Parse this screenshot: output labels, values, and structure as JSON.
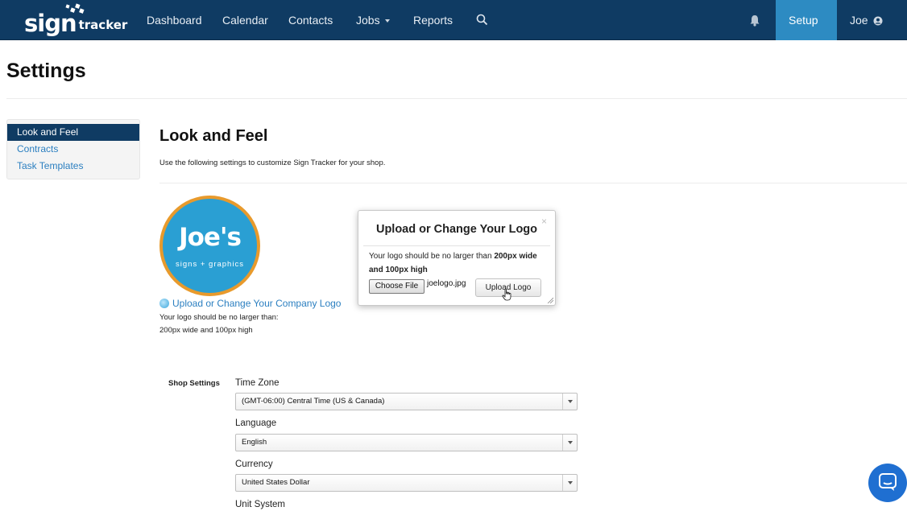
{
  "nav": {
    "brand_sign": "sign",
    "brand_tracker": "tracker",
    "items": [
      {
        "label": "Dashboard"
      },
      {
        "label": "Calendar"
      },
      {
        "label": "Contacts"
      },
      {
        "label": "Jobs"
      },
      {
        "label": "Reports"
      }
    ],
    "search_icon": "search-icon",
    "bell_icon": "bell-icon",
    "setup_label": "Setup",
    "user_label": "Joe",
    "user_icon": "user-circle-icon",
    "colors": {
      "bar": "#0f3b63",
      "setup_active": "#2d8bc2"
    }
  },
  "page": {
    "title": "Settings"
  },
  "sidebar": {
    "items": [
      {
        "label": "Look and Feel",
        "active": true
      },
      {
        "label": "Contracts",
        "active": false
      },
      {
        "label": "Task Templates",
        "active": false
      }
    ]
  },
  "main": {
    "title": "Look and Feel",
    "description": "Use the following settings to customize Sign Tracker for your shop.",
    "company_logo": {
      "name": "Joe's",
      "tagline": "signs + graphics"
    },
    "upload_link": "Upload or Change Your Company Logo",
    "logo_note_1": "Your logo should be no larger than:",
    "logo_note_2": "200px wide and 100px high"
  },
  "modal": {
    "title": "Upload or Change Your Logo",
    "close": "×",
    "text_pre": "Your logo should be no larger than ",
    "text_bold": "200px wide and 100px high",
    "choose_file_label": "Choose File",
    "file_name": "joelogo.jpg",
    "upload_button": "Upload Logo"
  },
  "shop_settings": {
    "section_label": "Shop Settings",
    "fields": [
      {
        "label": "Time Zone",
        "value": "(GMT-06:00) Central Time (US & Canada)"
      },
      {
        "label": "Language",
        "value": "English"
      },
      {
        "label": "Currency",
        "value": "United States Dollar"
      },
      {
        "label": "Unit System",
        "value": ""
      }
    ]
  },
  "chat_icon": "chat-bubble-icon"
}
